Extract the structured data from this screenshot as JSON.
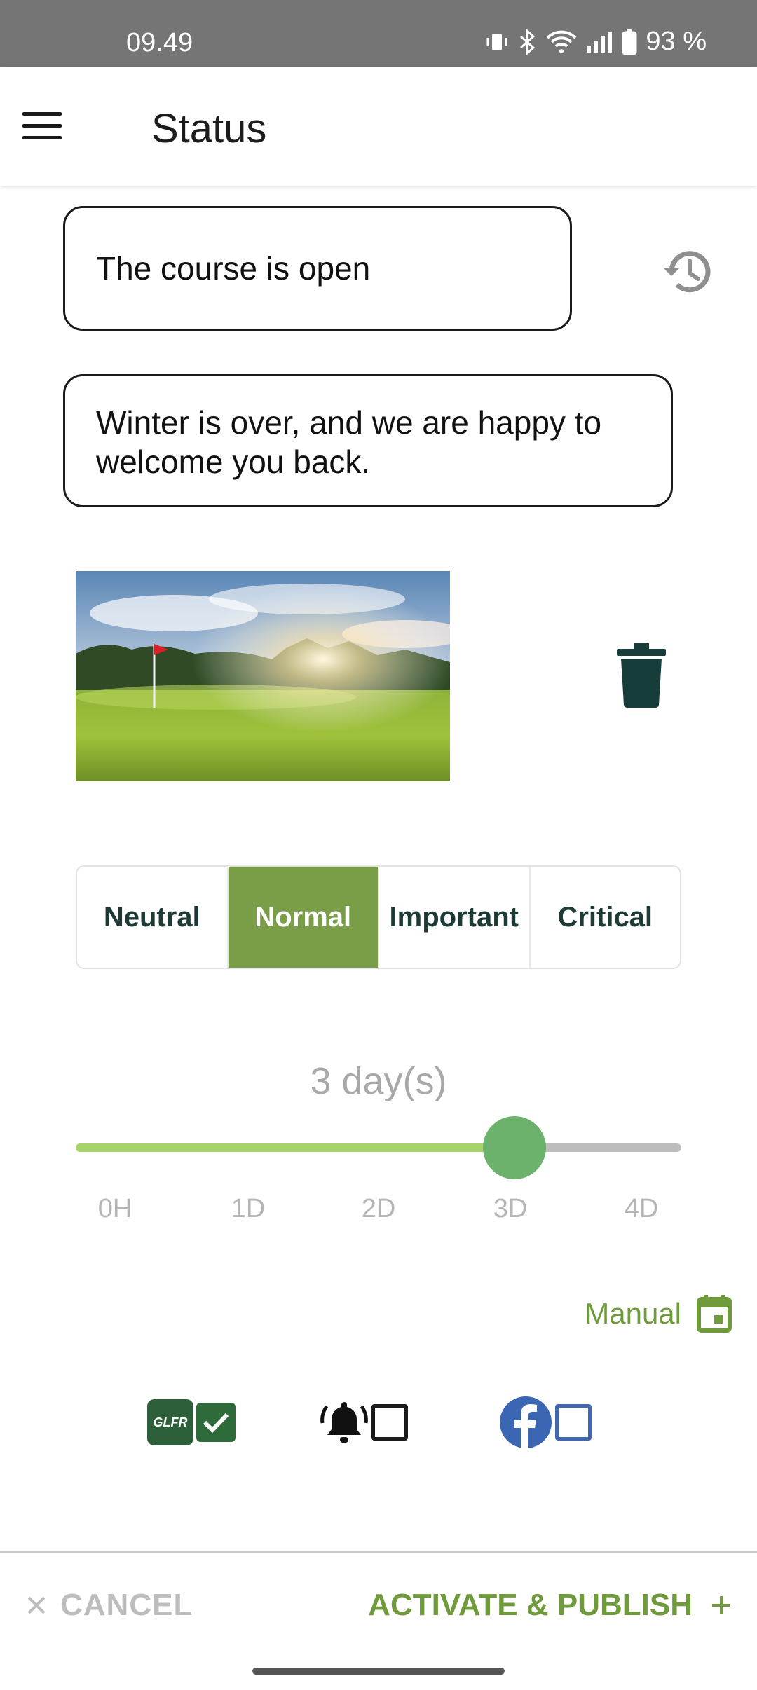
{
  "status_bar": {
    "time": "09.49",
    "battery": "93 %"
  },
  "appbar": {
    "title": "Status"
  },
  "form": {
    "title_value": "The course is open",
    "message_value": "Winter is over, and we are happy to welcome you back."
  },
  "severity": {
    "options": [
      "Neutral",
      "Normal",
      "Important",
      "Critical"
    ],
    "selected": "Normal"
  },
  "duration": {
    "label": "3 day(s)",
    "ticks": [
      "0H",
      "1D",
      "2D",
      "3D",
      "4D"
    ],
    "value_fraction": 0.725
  },
  "manual_label": "Manual",
  "channels": {
    "glfr_text": "GLFR",
    "glfr_checked": true,
    "notification_checked": false,
    "facebook_checked": false
  },
  "actions": {
    "cancel": "CANCEL",
    "publish": "ACTIVATE & PUBLISH"
  },
  "colors": {
    "accent_green": "#7a9e48",
    "dark_teal": "#1d3a36",
    "slider_fill": "#a6d46c",
    "thumb": "#6cb26c",
    "facebook_blue": "#4267b2"
  }
}
